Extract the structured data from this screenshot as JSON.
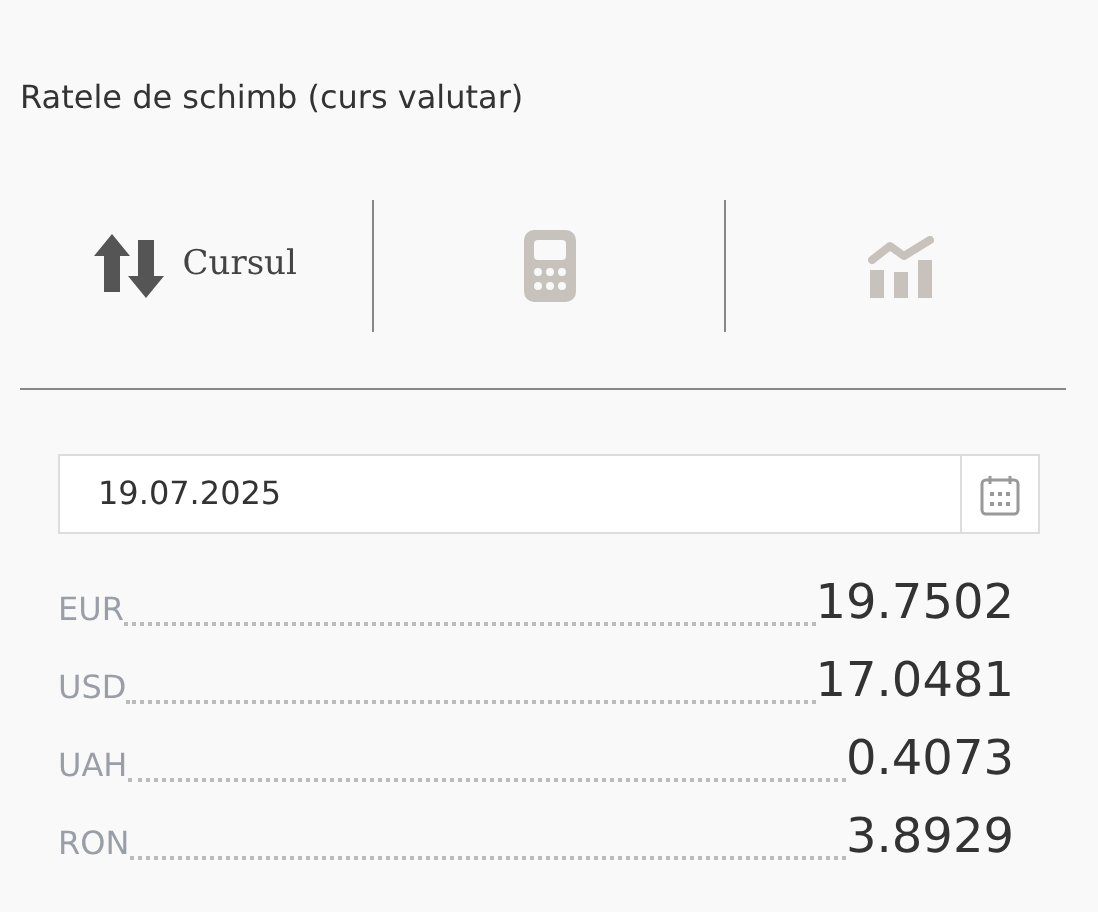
{
  "title": "Ratele de schimb (curs valutar)",
  "tabs": [
    {
      "kind": "rates",
      "label": "Cursul",
      "selected": true
    },
    {
      "kind": "calculator",
      "selected": false
    },
    {
      "kind": "chart",
      "selected": false
    }
  ],
  "date_field": {
    "value": "19.07.2025"
  },
  "rates": [
    {
      "currency": "EUR",
      "value": "19.7502"
    },
    {
      "currency": "USD",
      "value": "17.0481"
    },
    {
      "currency": "UAH",
      "value": "0.4073"
    },
    {
      "currency": "RON",
      "value": "3.8929"
    }
  ]
}
